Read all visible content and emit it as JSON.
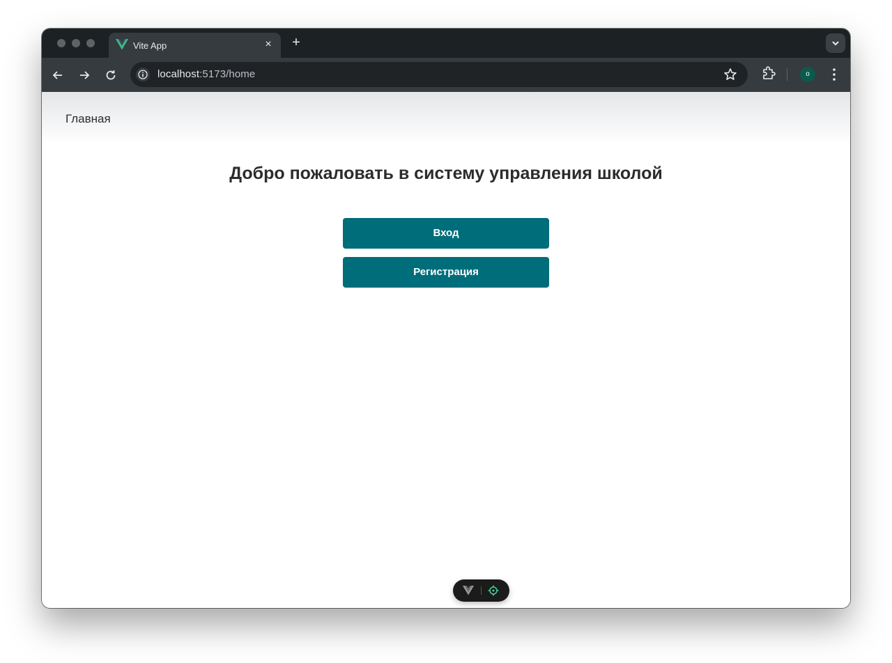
{
  "browser": {
    "tab_title": "Vite App",
    "tab_close_glyph": "×",
    "new_tab_glyph": "+",
    "url_host": "localhost",
    "url_rest": ":5173/home",
    "avatar_letter": "o",
    "icons": [
      "vue-favicon-icon",
      "back-arrow-icon",
      "forward-arrow-icon",
      "reload-icon",
      "site-info-icon",
      "bookmark-star-icon",
      "extensions-puzzle-icon",
      "kebab-menu-icon",
      "tab-search-chevron-icon"
    ]
  },
  "app": {
    "nav_home": "Главная",
    "heading": "Добро пожаловать в систему управления школой",
    "login_label": "Вход",
    "register_label": "Регистрация",
    "accent_color": "#006d7a"
  },
  "devtools": {
    "icons": [
      "vue-devtools-logo-icon",
      "inspect-target-icon"
    ]
  }
}
